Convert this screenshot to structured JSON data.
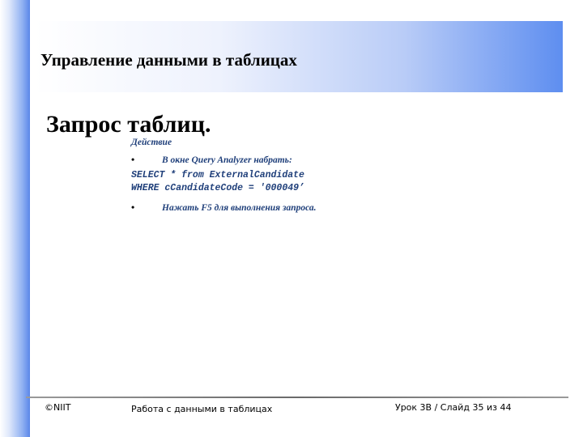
{
  "slide": {
    "title": "Управление данными в таблицах",
    "subtitle": "Запрос таблиц."
  },
  "content": {
    "action_label": "Действие",
    "bullet_char": "•",
    "step1": "В окне Query Analyzer набрать:",
    "code_line1": "SELECT * from ExternalCandidate",
    "code_line2": "WHERE cCandidateCode = '000049’",
    "step2": "Нажать F5 для выполнения запроса."
  },
  "footer": {
    "copyright": "©NIIT",
    "center": "Работа с данными в таблицах",
    "page_info": "Урок 3B / Слайд 35 из 44"
  },
  "colors": {
    "accent_blue": "#5e8ef0",
    "body_text_blue": "#1f3f7a"
  }
}
